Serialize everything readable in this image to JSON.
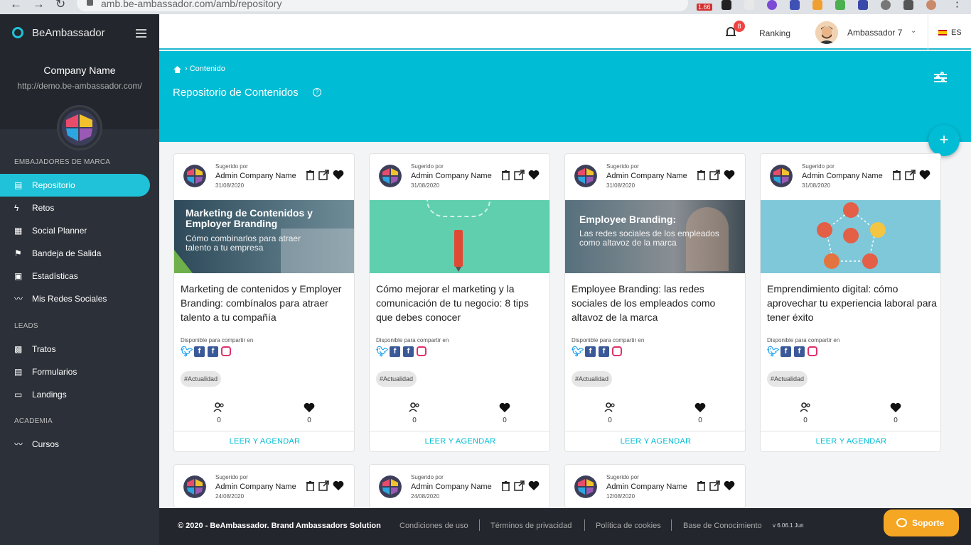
{
  "browser": {
    "url": "amb.be-ambassador.com/amb/repository",
    "ext_badge": "1.66"
  },
  "sidebar": {
    "brand": "BeAmbassador",
    "company_name": "Company Name",
    "company_url": "http://demo.be-ambassador.com/",
    "sections": [
      {
        "label": "EMBAJADORES DE MARCA"
      },
      {
        "label": "LEADS"
      },
      {
        "label": "ACADEMIA"
      }
    ],
    "items": [
      {
        "label": "Repositorio",
        "icon": "repository-icon",
        "active": true
      },
      {
        "label": "Retos",
        "icon": "bolt-icon"
      },
      {
        "label": "Social Planner",
        "icon": "calendar-icon"
      },
      {
        "label": "Bandeja de Salida",
        "icon": "flag-icon"
      },
      {
        "label": "Estadísticas",
        "icon": "stats-icon"
      },
      {
        "label": "Mis Redes Sociales",
        "icon": "trend-icon"
      },
      {
        "label": "Tratos",
        "icon": "briefcase-icon"
      },
      {
        "label": "Formularios",
        "icon": "form-icon"
      },
      {
        "label": "Landings",
        "icon": "landing-icon"
      },
      {
        "label": "Cursos",
        "icon": "trend-icon"
      }
    ]
  },
  "topbar": {
    "notifications": "8",
    "ranking": "Ranking",
    "user": "Ambassador 7",
    "lang": "ES"
  },
  "hero": {
    "breadcrumb": "Contenido",
    "title": "Repositorio de Contenidos",
    "help": "?",
    "fab": "+"
  },
  "cards": [
    {
      "suggested": "Sugerido por",
      "author": "Admin Company Name",
      "date": "31/08/2020",
      "image_title": "Marketing de Contenidos y Employer Branding",
      "image_sub": "Cómo combinarlos para atraer talento a tu empresa",
      "title": "Marketing de contenidos y Employer Branding: combínalos para atraer talento a tu compañía",
      "available": "Disponible para compartir en",
      "tag": "#Actualidad",
      "users": "0",
      "likes": "0",
      "cta": "LEER Y AGENDAR"
    },
    {
      "suggested": "Sugerido por",
      "author": "Admin Company Name",
      "date": "31/08/2020",
      "title": "Cómo mejorar el marketing y la comunicación de tu negocio: 8 tips que debes conocer",
      "available": "Disponible para compartir en",
      "tag": "#Actualidad",
      "users": "0",
      "likes": "0",
      "cta": "LEER Y AGENDAR"
    },
    {
      "suggested": "Sugerido por",
      "author": "Admin Company Name",
      "date": "31/08/2020",
      "image_title": "Employee Branding:",
      "image_sub": "Las redes sociales de los empleados como altavoz de la marca",
      "title": "Employee Branding: las redes sociales de los empleados como altavoz de la marca",
      "available": "Disponible para compartir en",
      "tag": "#Actualidad",
      "users": "0",
      "likes": "0",
      "cta": "LEER Y AGENDAR"
    },
    {
      "suggested": "Sugerido por",
      "author": "Admin Company Name",
      "date": "31/08/2020",
      "title": "Emprendimiento digital: cómo aprovechar tu experiencia laboral para tener éxito",
      "available": "Disponible para compartir en",
      "tag": "#Actualidad",
      "users": "0",
      "likes": "0",
      "cta": "LEER Y AGENDAR"
    },
    {
      "suggested": "Sugerido por",
      "author": "Admin Company Name",
      "date": "24/08/2020"
    },
    {
      "suggested": "Sugerido por",
      "author": "Admin Company Name",
      "date": "24/08/2020"
    },
    {
      "suggested": "Sugerido por",
      "author": "Admin Company Name",
      "date": "12/08/2020"
    }
  ],
  "footer": {
    "copyright": "© 2020 - BeAmbassador. Brand Ambassadors Solution",
    "links": [
      "Condiciones de uso",
      "Términos de privacidad",
      "Política de cookies",
      "Base de Conocimiento"
    ],
    "version": "v 6.06.1 Jun"
  },
  "support": "Soporte",
  "colors": {
    "accent": "#00bcd4",
    "sidebar": "#2c3038",
    "support": "#f5a623",
    "badge": "#ef4444"
  }
}
